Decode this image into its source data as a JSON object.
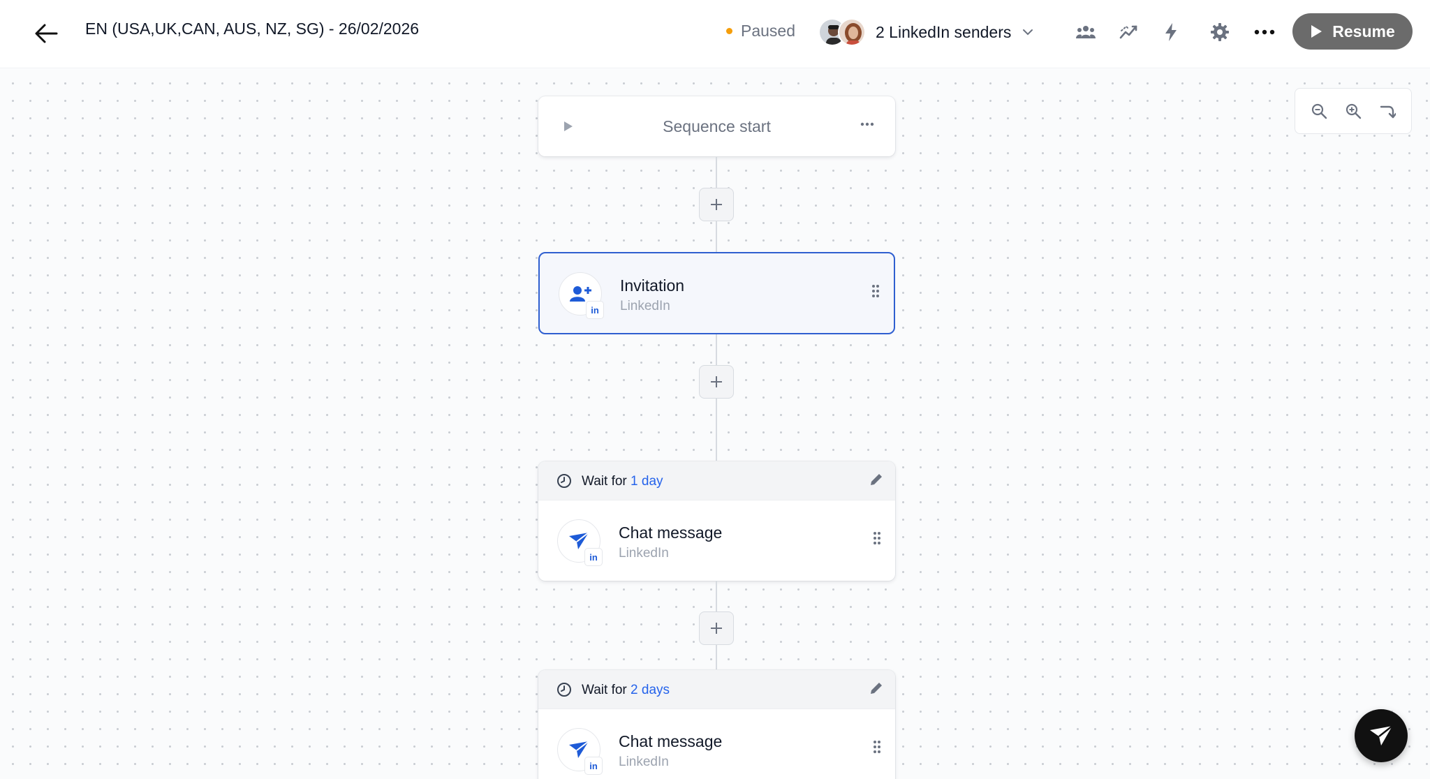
{
  "header": {
    "title": "EN (USA,UK,CAN, AUS, NZ, SG) - 26/02/2026",
    "status": "Paused",
    "senders_label": "2 LinkedIn senders",
    "resume_label": "Resume"
  },
  "colors": {
    "accent": "#2f5fd0",
    "status_paused": "#f59e0b",
    "resume_bg": "#6b6b6b",
    "link_blue": "#2563eb"
  },
  "icons": [
    "back-arrow-icon",
    "team-icon",
    "analytics-icon",
    "bolt-icon",
    "gear-icon",
    "more-icon",
    "play-icon",
    "zoom-out-icon",
    "zoom-in-icon",
    "redo-icon",
    "add-user-icon",
    "send-icon",
    "clock-icon",
    "pencil-icon",
    "drag-handle-icon"
  ],
  "canvas": {
    "start": {
      "label": "Sequence start"
    },
    "steps": [
      {
        "title": "Invitation",
        "channel": "LinkedIn",
        "badge": "in"
      },
      {
        "wait_prefix": "Wait for",
        "wait_value": "1 day",
        "title": "Chat message",
        "channel": "LinkedIn",
        "badge": "in"
      },
      {
        "wait_prefix": "Wait for",
        "wait_value": "2 days",
        "title": "Chat message",
        "channel": "LinkedIn",
        "badge": "in"
      }
    ]
  }
}
